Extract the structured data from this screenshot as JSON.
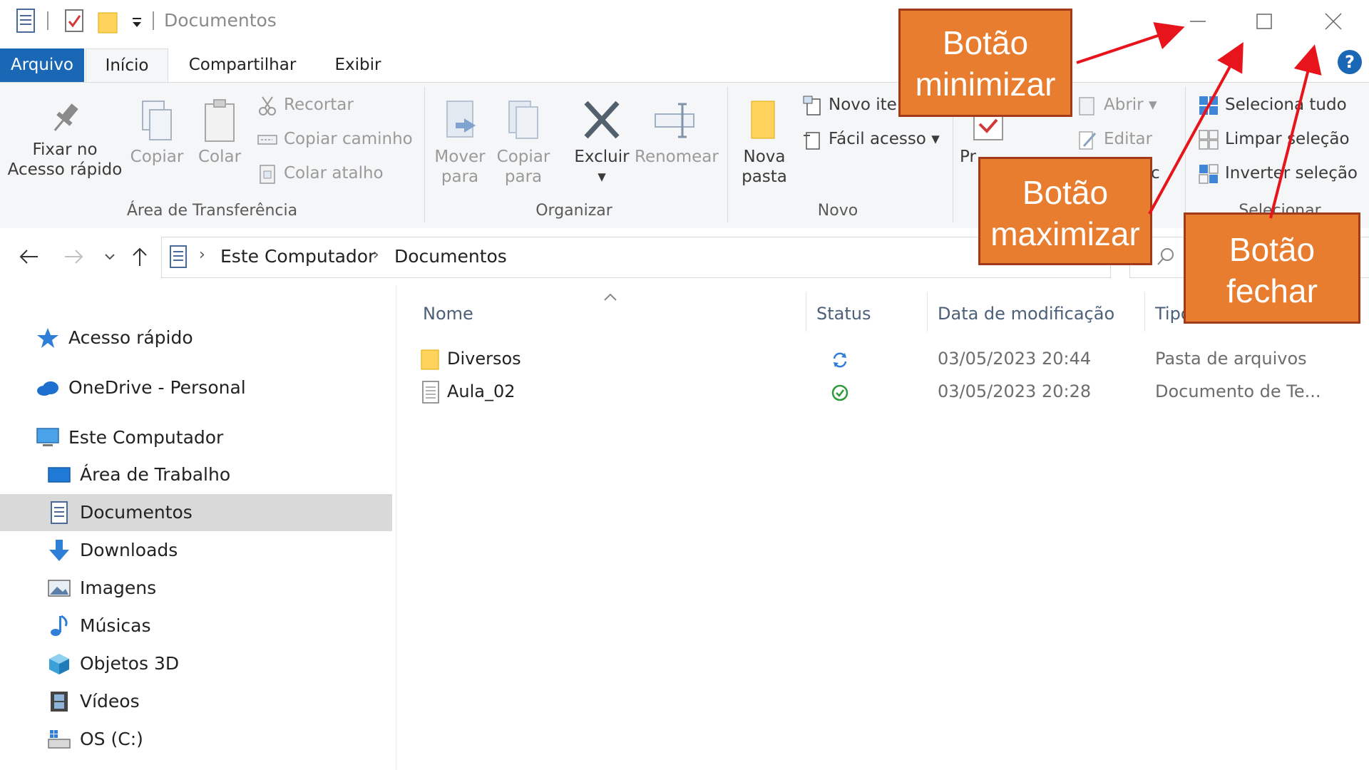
{
  "window": {
    "title": "Documentos",
    "controls": [
      "minimize-icon",
      "maximize-icon",
      "close-icon"
    ]
  },
  "tabs": [
    {
      "label": "Arquivo",
      "style": "file"
    },
    {
      "label": "Início",
      "active": true
    },
    {
      "label": "Compartilhar"
    },
    {
      "label": "Exibir"
    }
  ],
  "help_label": "?",
  "ribbon": {
    "clipboard": {
      "pin_line1": "Fixar no",
      "pin_line2": "Acesso rápido",
      "copy": "Copiar",
      "paste": "Colar",
      "cut": "Recortar",
      "copy_path": "Copiar caminho",
      "paste_shortcut": "Colar atalho",
      "group_label": "Área de Transferência"
    },
    "organize": {
      "move_line1": "Mover",
      "move_line2": "para",
      "copy_line1": "Copiar",
      "copy_line2": "para",
      "delete": "Excluir",
      "rename": "Renomear",
      "group_label": "Organizar"
    },
    "new": {
      "new_folder_line1": "Nova",
      "new_folder_line2": "pasta",
      "new_item": "Novo ite",
      "easy_access": "Fácil acesso",
      "group_label": "Novo"
    },
    "open": {
      "properties_partial": "Pr",
      "open": "Abrir",
      "edit": "Editar",
      "history_partial": "c"
    },
    "select": {
      "select_all": "Seleciona tudo",
      "clear_selection": "Limpar seleção",
      "invert_selection": "Inverter seleção",
      "group_label_partial": "Selecionar"
    }
  },
  "address": {
    "crumbs": [
      "Este Computador",
      "Documentos"
    ],
    "search_icon": "search-icon"
  },
  "nav_pane": {
    "items": [
      {
        "label": "Acesso rápido",
        "icon": "star-icon"
      },
      {
        "label": "OneDrive - Personal",
        "icon": "cloud-icon"
      },
      {
        "label": "Este Computador",
        "icon": "computer-icon"
      },
      {
        "label": "Área de Trabalho",
        "icon": "desktop-icon"
      },
      {
        "label": "Documentos",
        "icon": "documents-icon",
        "selected": true
      },
      {
        "label": "Downloads",
        "icon": "download-arrow-icon"
      },
      {
        "label": "Imagens",
        "icon": "image-icon"
      },
      {
        "label": "Músicas",
        "icon": "music-note-icon"
      },
      {
        "label": "Objetos 3D",
        "icon": "cube-icon"
      },
      {
        "label": "Vídeos",
        "icon": "film-icon"
      },
      {
        "label": "OS (C:)",
        "icon": "drive-icon"
      }
    ]
  },
  "file_list": {
    "columns": [
      "Nome",
      "Status",
      "Data de modificação",
      "Tipo"
    ],
    "rows": [
      {
        "name": "Diversos",
        "icon": "folder-icon",
        "status": "sync-icon",
        "date": "03/05/2023 20:44",
        "type": "Pasta de arquivos"
      },
      {
        "name": "Aula_02",
        "icon": "text-file-icon",
        "status": "synced-check-icon",
        "date": "03/05/2023 20:28",
        "type": "Documento de Te..."
      }
    ]
  },
  "annotations": [
    {
      "line1": "Botão",
      "line2": "minimizar"
    },
    {
      "line1": "Botão",
      "line2": "maximizar"
    },
    {
      "line1": "Botão",
      "line2": "fechar"
    }
  ],
  "colors": {
    "accent_blue": "#1a67b5",
    "callout_fill": "#e87d2f",
    "callout_border": "#a23b1c",
    "arrow_red": "#e8141b",
    "selected_row": "#d9d9d9"
  }
}
